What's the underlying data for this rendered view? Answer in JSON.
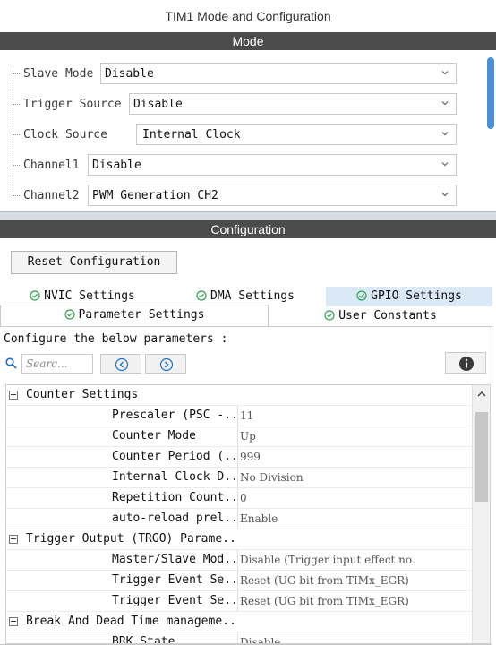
{
  "window": {
    "title": "TIM1 Mode and Configuration"
  },
  "mode": {
    "header": "Mode",
    "rows": [
      {
        "label": "Slave Mode",
        "value": "Disable"
      },
      {
        "label": "Trigger Source",
        "value": "Disable"
      },
      {
        "label": "Clock Source",
        "value": "Internal Clock"
      },
      {
        "label": "Channel1",
        "value": "Disable"
      },
      {
        "label": "Channel2",
        "value": "PWM Generation CH2"
      }
    ]
  },
  "configuration": {
    "header": "Configuration",
    "reset_label": "Reset Configuration",
    "tabs_row1": [
      "NVIC Settings",
      "DMA Settings",
      "GPIO Settings"
    ],
    "tabs_row2": [
      "Parameter Settings",
      "User Constants"
    ],
    "hint": "Configure the below parameters :",
    "search_placeholder": "Searc...",
    "groups": [
      {
        "title": "Counter Settings",
        "params": [
          {
            "name": "Prescaler (PSC -..",
            "value": "11"
          },
          {
            "name": "Counter Mode",
            "value": "Up"
          },
          {
            "name": "Counter Period (..",
            "value": "999"
          },
          {
            "name": "Internal Clock D..",
            "value": "No Division"
          },
          {
            "name": "Repetition Count..",
            "value": "0"
          },
          {
            "name": "auto-reload prel..",
            "value": "Enable"
          }
        ]
      },
      {
        "title": "Trigger Output (TRGO) Parame..",
        "params": [
          {
            "name": "Master/Slave Mod..",
            "value": "Disable (Trigger input effect no."
          },
          {
            "name": "Trigger Event Se..",
            "value": "Reset (UG bit from TIMx_EGR)"
          },
          {
            "name": "Trigger Event Se..",
            "value": "Reset (UG bit from TIMx_EGR)"
          }
        ]
      },
      {
        "title": "Break And Dead Time manageme..",
        "params": [
          {
            "name": "BRK State",
            "value": "Disable"
          }
        ]
      }
    ]
  },
  "colors": {
    "accent": "#4a90d9",
    "header_bg": "#4b4b4b",
    "tab_active": "#dbe9f7",
    "check_green": "#2ea44f"
  }
}
